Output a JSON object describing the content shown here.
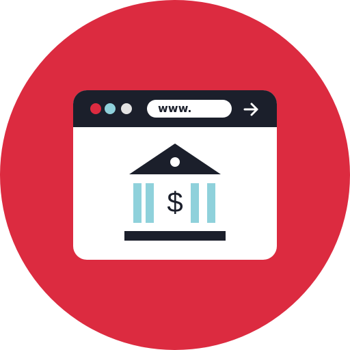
{
  "icon": {
    "name": "online-banking",
    "background_color": "#dc2b40",
    "frame_color": "#1b1f2b",
    "window_color": "#ffffff",
    "column_color": "#8fd1db"
  },
  "browser": {
    "dots": [
      {
        "name": "red-dot",
        "color": "#dc2b40"
      },
      {
        "name": "blue-dot",
        "color": "#8fd1db"
      },
      {
        "name": "gray-dot",
        "color": "#e3e3e3"
      }
    ],
    "address_text": "www.",
    "go_icon": "arrow-right-icon"
  },
  "content": {
    "bank_icon": "bank-building-icon",
    "symbol": "$"
  }
}
